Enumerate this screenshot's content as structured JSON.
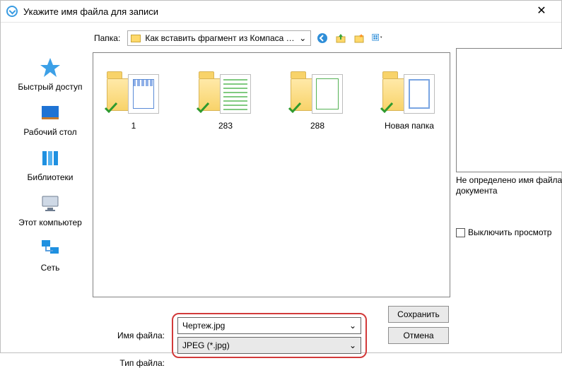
{
  "window": {
    "title": "Укажите имя файла для записи"
  },
  "toolbar": {
    "folder_label": "Папка:",
    "folder_value": "Как вставить фрагмент из Компаса в Вор",
    "nav": {
      "back": "back-icon",
      "up": "up-icon",
      "new_folder": "new-folder-icon",
      "view": "view-menu-icon"
    }
  },
  "places": [
    {
      "id": "quick",
      "label": "Быстрый доступ"
    },
    {
      "id": "desktop",
      "label": "Рабочий стол"
    },
    {
      "id": "libs",
      "label": "Библиотеки"
    },
    {
      "id": "thispc",
      "label": "Этот компьютер"
    },
    {
      "id": "network",
      "label": "Сеть"
    }
  ],
  "items": [
    {
      "name": "1",
      "style": "blue"
    },
    {
      "name": "283",
      "style": "green"
    },
    {
      "name": "288",
      "style": "greenframe"
    },
    {
      "name": "Новая папка",
      "style": "blueframe"
    }
  ],
  "form": {
    "filename_label": "Имя файла:",
    "filename_value": "Чертеж.jpg",
    "filetype_label": "Тип файла:",
    "filetype_value": "JPEG (*.jpg)",
    "save_label": "Сохранить",
    "cancel_label": "Отмена"
  },
  "preview": {
    "status": "Не определено имя файла документа",
    "toggle_label": "Выключить просмотр"
  }
}
